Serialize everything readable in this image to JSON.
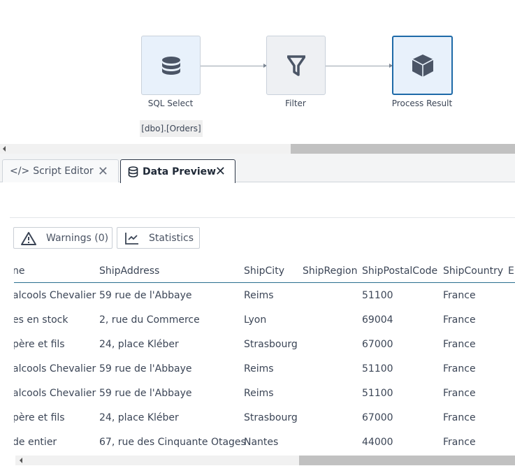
{
  "pipeline": {
    "nodes": [
      {
        "label": "SQL Select",
        "icon": "database-icon",
        "tooltip": "[dbo].[Orders]"
      },
      {
        "label": "Filter",
        "icon": "filter-icon"
      },
      {
        "label": "Process Result",
        "icon": "cube-icon",
        "selected": true
      }
    ]
  },
  "tabs": [
    {
      "label": "Script Editor",
      "icon": "code-icon",
      "active": false
    },
    {
      "label": "Data Preview",
      "icon": "database-icon",
      "active": true
    }
  ],
  "toolbar": {
    "warnings_label": "Warnings (0)",
    "statistics_label": "Statistics"
  },
  "table": {
    "columns": [
      "ne",
      "ShipAddress",
      "ShipCity",
      "ShipRegion",
      "ShipPostalCode",
      "ShipCountry",
      "E"
    ],
    "rows": [
      [
        "alcools Chevalier",
        "59 rue de l'Abbaye",
        "Reims",
        "",
        "51100",
        "France"
      ],
      [
        "es en stock",
        "2, rue du Commerce",
        "Lyon",
        "",
        "69004",
        "France"
      ],
      [
        "père et fils",
        "24, place Kléber",
        "Strasbourg",
        "",
        "67000",
        "France"
      ],
      [
        "alcools Chevalier",
        "59 rue de l'Abbaye",
        "Reims",
        "",
        "51100",
        "France"
      ],
      [
        "alcools Chevalier",
        "59 rue de l'Abbaye",
        "Reims",
        "",
        "51100",
        "France"
      ],
      [
        "père et fils",
        "24, place Kléber",
        "Strasbourg",
        "",
        "67000",
        "France"
      ],
      [
        "de entier",
        "67, rue des Cinquante Otages",
        "Nantes",
        "",
        "44000",
        "France"
      ]
    ]
  },
  "colors": {
    "accent": "#1e6aa8",
    "header_rule": "#2a6f8f",
    "node_blue": "#e8f1fb",
    "node_gray": "#eef0f3"
  }
}
